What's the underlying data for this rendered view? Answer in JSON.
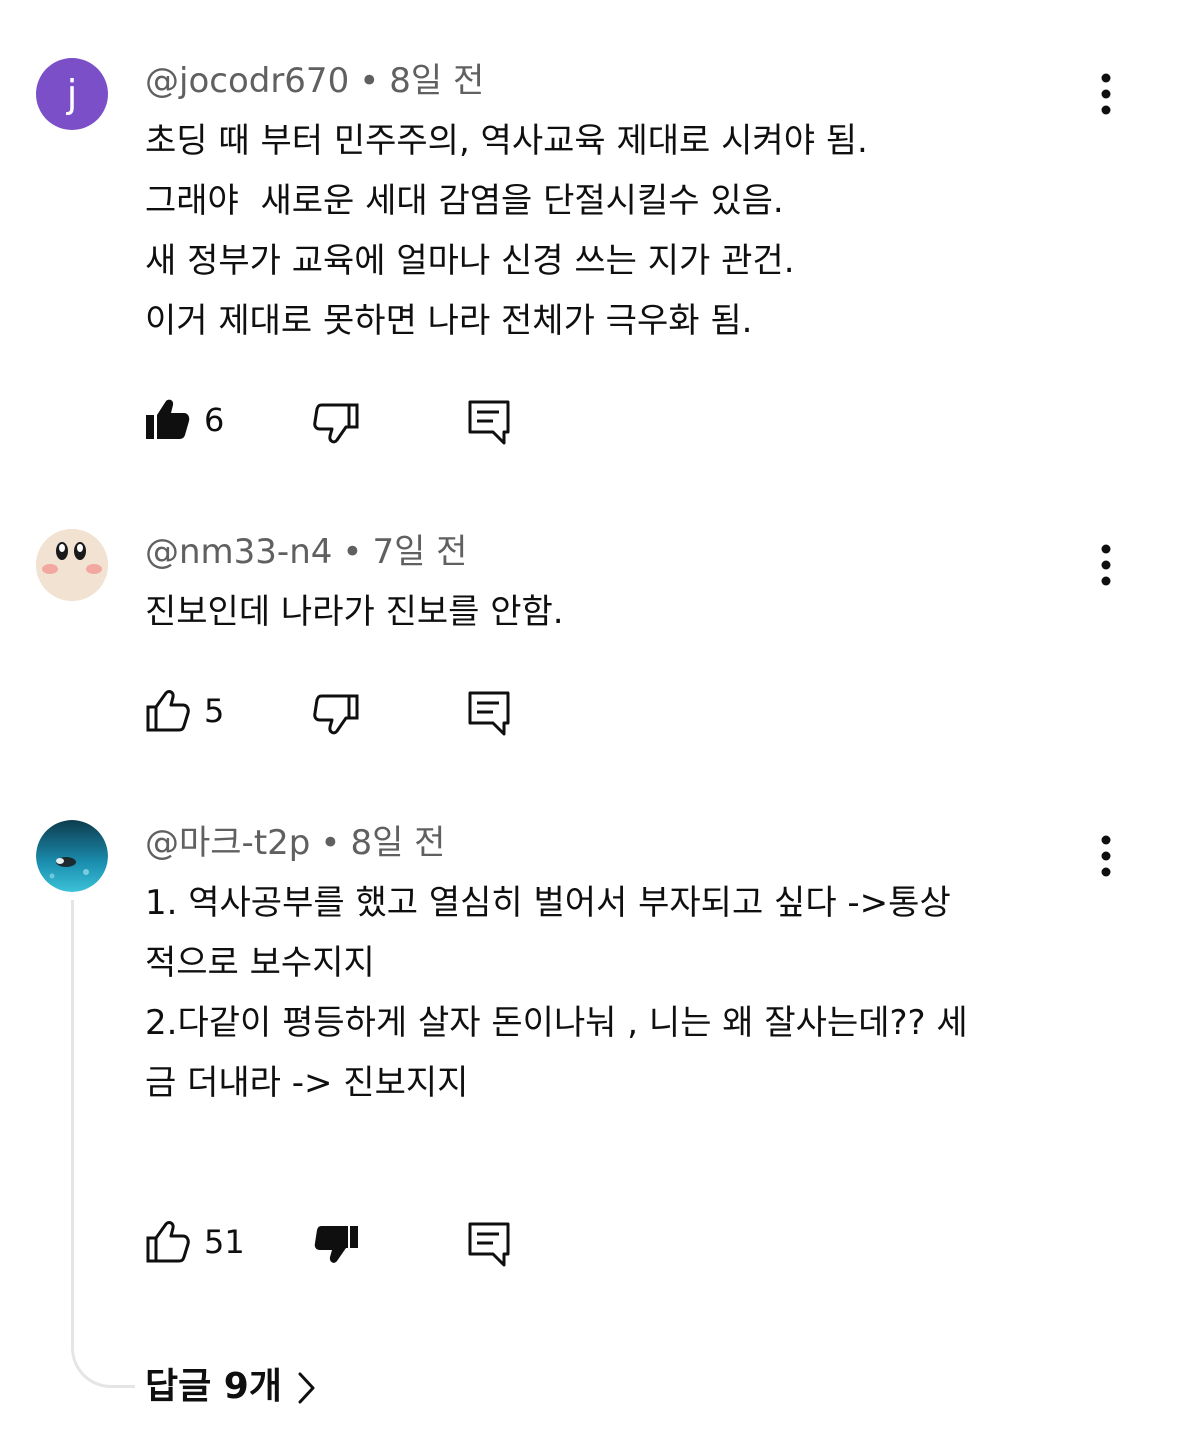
{
  "comments": [
    {
      "author": "@jocodr670",
      "avatar_letter": "j",
      "time": "8일 전",
      "lines": [
        "초딩 때 부터 민주주의, 역사교육 제대로 시켜야 됨.",
        "그래야  새로운 세대 감염을 단절시킬수 있음.",
        "새 정부가 교육에 얼마나 신경 쓰는 지가 관건.",
        "이거 제대로 못하면 나라 전체가 극우화 됨."
      ],
      "likes": "6",
      "liked": true,
      "disliked": false
    },
    {
      "author": "@nm33-n4",
      "time": "7일 전",
      "lines": [
        "진보인데 나라가 진보를 안함."
      ],
      "likes": "5",
      "liked": false,
      "disliked": false
    },
    {
      "author": "@마크-t2p",
      "time": "8일 전",
      "lines": [
        "1. 역사공부를 했고 열심히 벌어서 부자되고 싶다 ->통상",
        "적으로 보수지지",
        "",
        "2.다같이 평등하게 살자 돈이나눠 , 니는 왜 잘사는데?? 세",
        "금 더내라 -> 진보지지"
      ],
      "likes": "51",
      "liked": false,
      "disliked": true,
      "replies_label": "답글 9개"
    }
  ],
  "colors": {
    "avatar_j": "#7b4fc8",
    "meta_text": "#606060",
    "thread_line": "#e5e5e5"
  },
  "icons": [
    "thumb-up-icon",
    "thumb-down-icon",
    "reply-icon",
    "more-vert-icon",
    "chevron-right-icon"
  ]
}
